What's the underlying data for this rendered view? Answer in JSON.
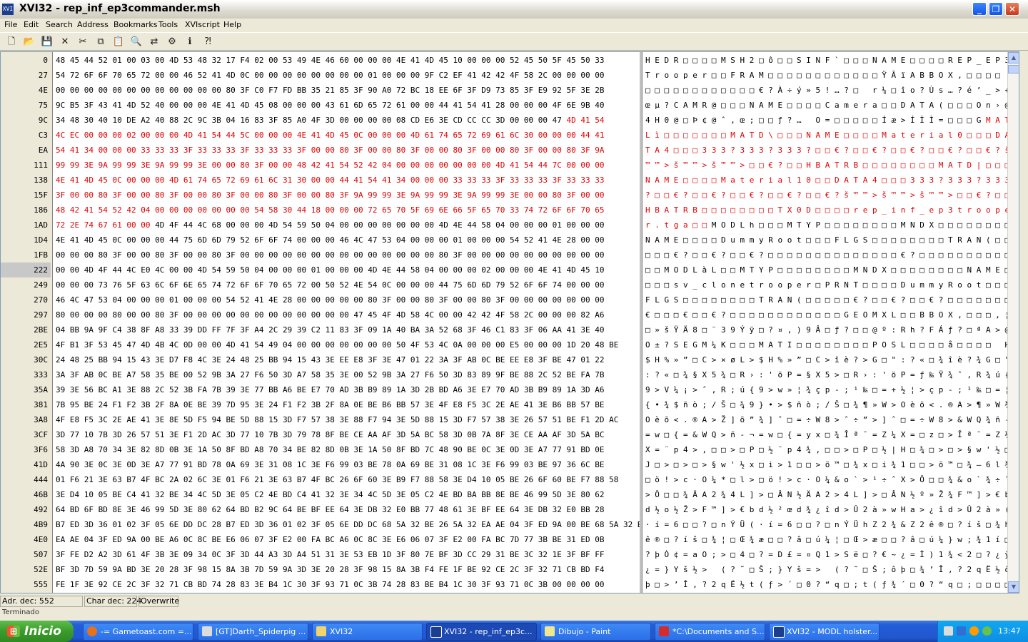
{
  "window": {
    "title": "XVI32 - rep_inf_ep3commander.msh",
    "app_icon": "XVI"
  },
  "menu": [
    "File",
    "Edit",
    "Search",
    "Address",
    "Bookmarks",
    "Tools",
    "XVIscript",
    "Help"
  ],
  "toolbar": [
    "new-file-icon",
    "open-folder-icon",
    "save-icon",
    "close-x-icon",
    "cut-icon",
    "copy-icon",
    "paste-icon",
    "find-icon",
    "replace-icon",
    "goto-icon",
    "script-icon",
    "help-icon"
  ],
  "rows": [
    {
      "addr": "0",
      "hex": "48 45 44 52 01 00 03 00 4D 53 48 32 17 F4 02 00 53 49 4E 46 60 00 00 00 4E 41 4D 45 10 00 00 00 52 45 50 5F 45 50 33",
      "text": "H E D R □ □ □ □ M S H 2 □ ô □ □ S I N F ` □ □ □ N A M E □ □ □ □ R E P _ E P 3",
      "color": ""
    },
    {
      "addr": "27",
      "hex": "54 72 6F 6F 70 65 72 00 00 46 52 41 4D 0C 00 00 00 00 00 00 00 00 01 00 00 00 9F C2 EF 41 42 42 4F 58 2C 00 00 00 00",
      "text": "T r o o p e r □ □ F R A M □ □ □ □ □ □ □ □ □ □ □ □ Ÿ Â ï A B B O X , □ □ □ □",
      "color": ""
    },
    {
      "addr": "4E",
      "hex": "00 00 00 00 00 00 00 00 00 00 00 00 80 3F C0 F7 FD BB 35 21 85 3F 90 A0 72 BC 18 EE 6F 3F D9 73 85 3F E9 92 5F 3E 2B",
      "text": "□ □ □ □ □ □ □ □ □ □ □ □ € ? À ÷ ý » 5 ! … ? □   r ¼ □ î o ? Ù s … ? é ’ _ > +",
      "color": ""
    },
    {
      "addr": "75",
      "hex": "9C B5 3F 43 41 4D 52 40 00 00 00 4E 41 4D 45 08 00 00 00 43 61 6D 65 72 61 00 00 44 41 54 41 28 00 00 00 4F 6E 9B 40",
      "text": "œ µ ? C A M R @ □ □ □ N A M E □ □ □ □ C a m e r a □ □ D A T A ( □ □ □ O n › @",
      "color": ""
    },
    {
      "addr": "9C",
      "hex": "34 48 30 40 10 DE A2 40 88 2C 9C 3B 04 16 83 3F 85 A0 4F 3D 00 00 00 00 08 CD E6 3E CD CC CC 3D 00 00 00 47 4D 41 54",
      "text": "4 H 0 @ □ Þ ¢ @ ˆ , œ ; □ □ ƒ ? …   O = □ □ □ □ □ Í æ > Í Ì Ì = □ □ □ G M A T",
      "color": "tail4"
    },
    {
      "addr": "C3",
      "hex": "4C EC 00 00 00 02 00 00 00 4D 41 54 44 5C 00 00 00 4E 41 4D 45 0C 00 00 00 4D 61 74 65 72 69 61 6C 30 00 00 00 44 41",
      "text": "L ì □ □ □ □ □ □ □ M A T D \\ □ □ □ N A M E □ □ □ □ M a t e r i a l 0 □ □ □ D A",
      "color": "all"
    },
    {
      "addr": "EA",
      "hex": "54 41 34 00 00 00 33 33 33 3F 33 33 33 3F 33 33 33 3F 00 00 80 3F 00 00 80 3F 00 00 80 3F 00 00 80 3F 00 00 80 3F 9A",
      "text": "T A 4 □ □ □ 3 3 3 ? 3 3 3 ? 3 3 3 ? □ □ € ? □ □ € ? □ □ € ? □ □ € ? □ □ € ? š",
      "color": "all"
    },
    {
      "addr": "111",
      "hex": "99 99 3E 9A 99 99 3E 9A 99 99 3E 00 00 80 3F 00 00 48 42 41 54 52 42 04 00 00 00 00 00 00 00 4D 41 54 44 7C 00 00 00",
      "text": "™ ™ > š ™ ™ > š ™ ™ > □ □ € ? □ □ H B A T R B □ □ □ □ □ □ □ □ M A T D | □ □ □",
      "color": "all"
    },
    {
      "addr": "138",
      "hex": "4E 41 4D 45 0C 00 00 00 4D 61 74 65 72 69 61 6C 31 30 00 00 44 41 54 41 34 00 00 00 33 33 33 3F 33 33 33 3F 33 33 33",
      "text": "N A M E □ □ □ □ M a t e r i a l 1 0 □ □ D A T A 4 □ □ □ 3 3 3 ? 3 3 3 ? 3 3 3",
      "color": "all"
    },
    {
      "addr": "15F",
      "hex": "3F 00 00 80 3F 00 00 80 3F 00 00 80 3F 00 00 80 3F 00 00 80 3F 9A 99 99 3E 9A 99 99 3E 9A 99 99 3E 00 00 80 3F 00 00",
      "text": "? □ □ € ? □ □ € ? □ □ € ? □ □ € ? □ □ € ? š ™ ™ > š ™ ™ > š ™ ™ > □ □ € ? □ □",
      "color": "all"
    },
    {
      "addr": "186",
      "hex": "48 42 41 54 52 42 04 00 00 00 00 00 00 00 54 58 30 44 18 00 00 00 72 65 70 5F 69 6E 66 5F 65 70 33 74 72 6F 6F 70 65",
      "text": "H B A T R B □ □ □ □ □ □ □ □ T X 0 D □ □ □ □ r e p _ i n f _ e p 3 t r o o p e",
      "color": "all"
    },
    {
      "addr": "1AD",
      "hex": "72 2E 74 67 61 00 00 4D 4F 44 4C 68 00 00 00 4D 54 59 50 04 00 00 00 00 00 00 00 4D 4E 44 58 04 00 00 00 01 00 00 00",
      "text": "r . t g a □ □ M O D L h □ □ □ M T Y P □ □ □ □ □ □ □ □ M N D X □ □ □ □ □ □ □ □",
      "color": "head7"
    },
    {
      "addr": "1D4",
      "hex": "4E 41 4D 45 0C 00 00 00 44 75 6D 6D 79 52 6F 6F 74 00 00 00 46 4C 47 53 04 00 00 00 01 00 00 00 54 52 41 4E 28 00 00",
      "text": "N A M E □ □ □ □ D u m m y R o o t □ □ □ F L G S □ □ □ □ □ □ □ □ T R A N ( □ □",
      "color": ""
    },
    {
      "addr": "1FB",
      "hex": "00 00 00 80 3F 00 00 80 3F 00 00 80 3F 00 00 00 00 00 00 00 00 00 00 00 00 00 00 80 3F 00 00 00 00 00 00 00 00 00 00",
      "text": "□ □ □ € ? □ □ € ? □ □ € ? □ □ □ □ □ □ □ □ □ □ □ □ □ □ € ? □ □ □ □ □ □ □ □ □ □",
      "color": ""
    },
    {
      "addr": "222",
      "hex": "00 00 4D 4F 44 4C E0 4C 00 00 4D 54 59 50 04 00 00 00 01 00 00 00 4D 4E 44 58 04 00 00 00 02 00 00 00 4E 41 4D 45 10",
      "text": "□ □ M O D L à L □ □ M T Y P □ □ □ □ □ □ □ □ M N D X □ □ □ □ □ □ □ □ N A M E □",
      "color": "",
      "sel": true
    },
    {
      "addr": "249",
      "hex": "00 00 00 73 76 5F 63 6C 6F 6E 65 74 72 6F 6F 70 65 72 00 50 52 4E 54 0C 00 00 00 44 75 6D 6D 79 52 6F 6F 74 00 00 00",
      "text": "□ □ □ s v _ c l o n e t r o o p e r □ P R N T □ □ □ □ D u m m y R o o t □ □ □",
      "color": ""
    },
    {
      "addr": "270",
      "hex": "46 4C 47 53 04 00 00 00 01 00 00 00 54 52 41 4E 28 00 00 00 00 00 80 3F 00 00 80 3F 00 00 80 3F 00 00 00 00 00 00 00",
      "text": "F L G S □ □ □ □ □ □ □ □ T R A N ( □ □ □ □ □ € ? □ □ € ? □ □ € ? □ □ □ □ □ □ □",
      "color": ""
    },
    {
      "addr": "297",
      "hex": "80 00 00 00 80 00 00 80 3F 00 00 00 00 00 00 00 00 00 00 00 00 47 45 4F 4D 58 4C 00 00 42 42 4F 58 2C 00 00 00 82 A6",
      "text": "€ □ □ □ € □ □ € ? □ □ □ □ □ □ □ □ □ □ □ □ G E O M X L □ □ B B O X , □ □ □ ‚ ¦",
      "color": ""
    },
    {
      "addr": "2BE",
      "hex": "04 BB 9A 9F C4 38 8F A8 33 39 DD FF 7F 3F A4 2C 29 39 C2 11 83 3F 09 1A 40 BA 3A 52 68 3F 46 C1 83 3F 06 AA 41 3E 40",
      "text": "□ » š Ÿ Ä 8 □ ¨ 3 9 Ý ÿ □ ? ¤ , ) 9 Â □ ƒ ? □ □ @ º : R h ? F Á ƒ ? □ ª A > @",
      "color": ""
    },
    {
      "addr": "2E5",
      "hex": "4F B1 3F 53 45 47 4D 4B 4C 0D 00 00 4D 41 54 49 04 00 00 00 00 00 00 00 50 4F 53 4C 0A 00 00 00 E5 00 00 00 1D 20 48 BE",
      "text": "O ± ? S E G M ¼ K □ □ □ M A T I □ □ □ □ □ □ □ □ P O S L □ □ □ □ å □ □ □ □   H ¾",
      "color": ""
    },
    {
      "addr": "30C",
      "hex": "24 48 25 BB 94 15 43 3E D7 F8 4C 3E 24 48 25 BB 94 15 43 3E EE E8 3F 3E 47 01 22 3A 3F AB 0C BE EE E8 3F BE 47 01 22",
      "text": "$ H % » ” □ C > × ø L > $ H % » ” □ C > î è ? > G □ \" : ? « □ ¾ î è ? ¾ G □ \"",
      "color": ""
    },
    {
      "addr": "333",
      "hex": "3A 3F AB 0C BE A7 58 35 BE 00 52 9B 3A 27 F6 50 3D A7 58 35 3E 00 52 9B 3A 27 F6 50 3D 83 89 9F BE 88 2C 52 BE FA 7B",
      "text": ": ? « □ ¾ § X 5 ¾ □ R › : ' ö P = § X 5 > □ R › : ' ö P = ƒ ‰ Ÿ ¾ ˆ , R ¾ ú {",
      "color": ""
    },
    {
      "addr": "35A",
      "hex": "39 3E 56 BC A1 3E 88 2C 52 3B FA 7B 39 3E 77 BB A6 BE E7 70 AD 3B B9 89 1A 3D 2B BD A6 3E E7 70 AD 3B B9 89 1A 3D A6",
      "text": "9 > V ¼ ¡ > ˆ , R ; ú { 9 > w » ¦ ¾ ç p - ; ¹ ‰ □ = + ½ ¦ > ç p - ; ¹ ‰ □ = ¦",
      "color": ""
    },
    {
      "addr": "381",
      "hex": "7B 95 BE 24 F1 F2 3B 2F 8A 0E BE 39 7D 95 3E 24 F1 F2 3B 2F 8A 0E BE B6 BB 57 3E 4F E8 F5 3C 2E AE 41 3E B6 BB 57 BE",
      "text": "{ • ¾ $ ñ ò ; / Š □ ¾ 9 } • > $ ñ ò ; / Š □ ¾ ¶ » W > O è õ < . ® A > ¶ » W ¾",
      "color": ""
    },
    {
      "addr": "3A8",
      "hex": "4F E8 F5 3C 2E AE 41 3E 8E 5D F5 94 BE 5D 88 15 3D F7 57 38 3E 88 F7 94 3E 5D 88 15 3D F7 57 38 3E 26 57 51 BE F1 2D AC",
      "text": "O è õ < . ® A > Ž ] õ ” ¾ ] ˆ □ = ÷ W 8 > ˆ ÷ ” > ] ˆ □ = ÷ W 8 > & W Q ¾ ñ - ¬",
      "color": ""
    },
    {
      "addr": "3CF",
      "hex": "3D 77 10 7B 3D 26 57 51 3E F1 2D AC 3D 77 10 7B 3D 79 78 8F BE CE AA AF 3D 5A BC 58 3D 0B 7A 8F 3E CE AA AF 3D 5A BC",
      "text": "= w □ { = & W Q > ñ - ¬ = w □ { = y x □ ¾ Î ª ¯ = Z ¼ X = □ z □ > Î ª ¯ = Z ¼",
      "color": ""
    },
    {
      "addr": "3F6",
      "hex": "58 3D A8 70 34 3E 82 8D 0B 3E 1A 50 8F BD A8 70 34 BE 82 8D 0B 3E 1A 50 8F BD 7C 48 90 BE 0C 3E 0D 3E A7 77 91 BD 0E",
      "text": "X = ¨ p 4 > ‚ □ □ > □ P □ ½ ¨ p 4 ¾ ‚ □ □ > □ P □ ½ | H □ ¾ □ > □ > § w ' ½ □",
      "color": ""
    },
    {
      "addr": "41D",
      "hex": "4A 90 3E 0C 3E 0D 3E A7 77 91 BD 78 0A 69 3E 31 08 1C 3E F6 99 03 BE 78 0A 69 BE 31 08 1C 3E F6 99 03 BE 97 36 6C BE",
      "text": "J □ > □ > □ > § w ' ½ x □ i > 1 □ □ > ö ™ □ ¾ x □ i ¾ 1 □ □ > ö ™ □ ¾ — 6 l ¾",
      "color": ""
    },
    {
      "addr": "444",
      "hex": "01 F6 21 3E 63 B7 4F BC 2A 02 6C 3E 01 F6 21 3E 63 B7 4F BC 26 6F 60 3E B9 F7 88 58 3E D4 10 05 BE 26 6F 60 BE F7 88 58",
      "text": "□ ö ! > c · O ¼ * □ l > □ ö ! > c · O ¼ & o ` > ¹ ÷ ˆ X > Ô □ □ ¾ & o ` ¾ ÷ ˆ X",
      "color": ""
    },
    {
      "addr": "46B",
      "hex": "3E D4 10 05 BE C4 41 32 BE 34 4C 5D 3E 05 C2 4E BD C4 41 32 3E 34 4C 5D 3E 05 C2 4E BD BA BB 8E BE 46 99 5D 3E 80 62",
      "text": "> Ô □ □ ¾ Ä A 2 ¾ 4 L ] > □ Â N ½ Ä A 2 > 4 L ] > □ Â N ½ º » Ž ¾ F ™ ] > € b",
      "color": ""
    },
    {
      "addr": "492",
      "hex": "64 BD 6F BD 8E 3E 46 99 5D 3E 80 62 64 BD B2 9C 64 BE BF EE 64 3E DB 32 E0 BB 77 48 61 3E BF EE 64 3E DB 32 E0 BB 28",
      "text": "d ½ o ½ Ž > F ™ ] > € b d ½ ² œ d ¾ ¿ î d > Û 2 à » w H a > ¿ î d > Û 2 à » (",
      "color": ""
    },
    {
      "addr": "4B9",
      "hex": "B7 ED 3D 36 01 02 3F 05 6E DD DC 28 B7 ED 3D 36 01 02 3F 05 6E DD DC 68 5A 32 BE 26 5A 32 EA AE 04 3F ED 9A 00 BE 68 5A 32 BE",
      "text": "· í = 6 □ □ ? □ n Ý Ü ( · í = 6 □ □ ? □ n Ý Ü h Z 2 ¾ & Z 2 ê ® □ ? í š □ ¾ h Z",
      "color": ""
    },
    {
      "addr": "4E0",
      "hex": "EA AE 04 3F ED 9A 00 BE A6 0C 8C BE E6 06 07 3F E2 00 FA BC A6 0C 8C 3E E6 06 07 3F E2 00 FA BC 7D 77 3B BE 31 ED 0B",
      "text": "ê ® □ ? í š □ ¾ ¦ □ Œ ¾ æ □ □ ? â □ ú ¼ ¦ □ Œ > æ □ □ ? â □ ú ¼ } w ; ¾ 1 í □",
      "color": ""
    },
    {
      "addr": "507",
      "hex": "3F FE D2 A2 3D 61 4F 3B 3E 09 34 0C 3F 3D 44 A3 3D A4 51 31 3E 53 EB 1D 3F 80 7E BF 3D CC 29 31 BE 3C 32 1E 3F BF FF",
      "text": "? þ Ò ¢ = a O ; > □ 4 □ ? = D £ = ¤ Q 1 > S ë □ ? € ~ ¿ = Ì ) 1 ¾ < 2 □ ? ¿ ÿ",
      "color": ""
    },
    {
      "addr": "52E",
      "hex": "BF 3D 7D 59 9A BD 3E 20 28 3F 98 15 8A 3B 7D 59 9A 3D 3E 20 28 3F 98 15 8A 3B F4 FE 1F BE 92 CE 2C 3F 32 71 CB BD F4",
      "text": "¿ = } Y š ½ >   ( ? ˜ □ Š ; } Y š = >   ( ? ˜ □ Š ; ô þ □ ¾ ’ Î , ? 2 q Ë ½ ô",
      "color": ""
    },
    {
      "addr": "555",
      "hex": "FE 1F 3E 92 CE 2C 3F 32 71 CB BD 74 28 83 3E B4 1C 30 3F 93 71 0C 3B 74 28 83 BE B4 1C 30 3F 93 71 0C 3B 00 00 00 00",
      "text": "þ □ > ’ Î , ? 2 q Ë ½ t ( ƒ > ´ □ 0 ? “ q □ ; t ( ƒ ¾ ´ □ 0 ? “ q □ ; □ □ □ □",
      "color": ""
    }
  ],
  "status": {
    "adr": "Adr. dec: 552",
    "char": "Char dec: 224",
    "mode": "Overwrite",
    "sub": "Terminado"
  },
  "taskbar": {
    "start": "Inicio",
    "items": [
      "-= Gametoast.com =...",
      "[GT]Darth_Spiderpig ...",
      "XVI32",
      "XVI32 - rep_inf_ep3c...",
      "Dibujo - Paint",
      "*C:\\Documents and S...",
      "XVI32 - MODL holster..."
    ],
    "clock": "13:47"
  },
  "colors": {
    "highlight": "#e00000",
    "taskbar": "#245dd7",
    "start": "#3a9b2b"
  }
}
